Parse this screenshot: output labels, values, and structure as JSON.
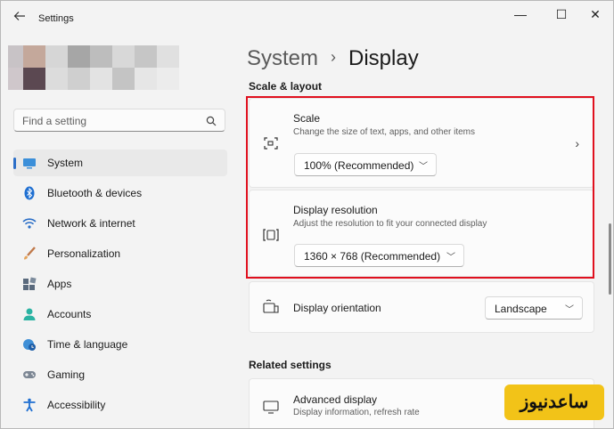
{
  "titlebar": {
    "app_title": "Settings",
    "back_icon": "back-arrow-icon",
    "minimize_glyph": "—",
    "maximize_glyph": "☐",
    "close_glyph": "✕"
  },
  "search": {
    "placeholder": "Find a setting"
  },
  "sidebar": {
    "items": [
      {
        "label": "System",
        "icon": "system-icon",
        "active": true
      },
      {
        "label": "Bluetooth & devices",
        "icon": "bluetooth-icon"
      },
      {
        "label": "Network & internet",
        "icon": "wifi-icon"
      },
      {
        "label": "Personalization",
        "icon": "brush-icon"
      },
      {
        "label": "Apps",
        "icon": "apps-icon"
      },
      {
        "label": "Accounts",
        "icon": "person-icon"
      },
      {
        "label": "Time & language",
        "icon": "clock-globe-icon"
      },
      {
        "label": "Gaming",
        "icon": "gamepad-icon"
      },
      {
        "label": "Accessibility",
        "icon": "accessibility-icon"
      }
    ]
  },
  "breadcrumb": {
    "parent": "System",
    "separator": "›",
    "current": "Display"
  },
  "scale_layout": {
    "heading": "Scale & layout",
    "scale": {
      "title": "Scale",
      "desc": "Change the size of text, apps, and other items",
      "value": "100% (Recommended)"
    },
    "resolution": {
      "title": "Display resolution",
      "desc": "Adjust the resolution to fit your connected display",
      "value": "1360 × 768 (Recommended)"
    },
    "orientation": {
      "title": "Display orientation",
      "value": "Landscape"
    }
  },
  "related": {
    "heading": "Related settings",
    "advanced": {
      "title": "Advanced display",
      "desc": "Display information, refresh rate"
    }
  },
  "watermark": {
    "text": "ساعدنیوز"
  },
  "colors": {
    "accent": "#2c6fc8",
    "highlight": "#e0101e",
    "watermark_bg": "#f2c318"
  }
}
